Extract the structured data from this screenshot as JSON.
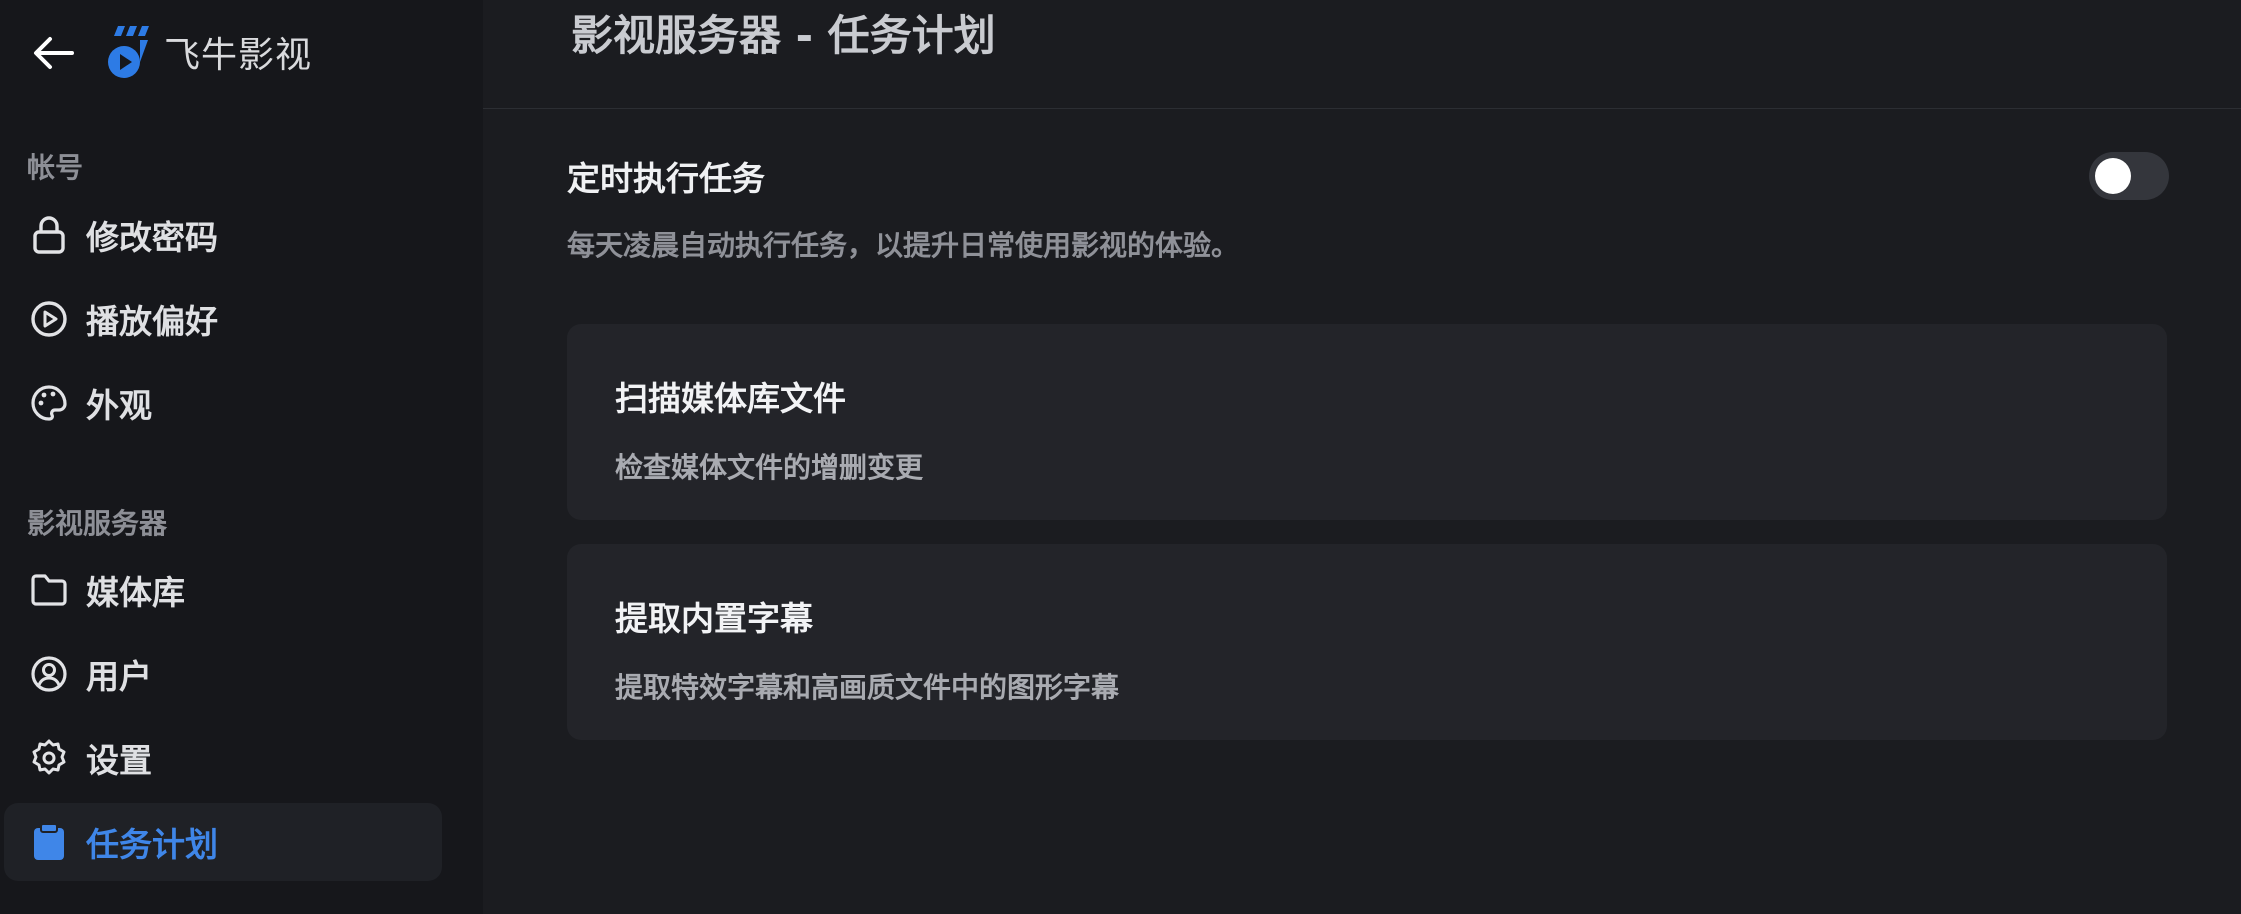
{
  "sidebar": {
    "brand_name": "飞牛影视",
    "sections": [
      {
        "title": "帐号",
        "items": [
          {
            "label": "修改密码",
            "icon": "lock-icon"
          },
          {
            "label": "播放偏好",
            "icon": "play-circle-icon"
          },
          {
            "label": "外观",
            "icon": "palette-icon"
          }
        ]
      },
      {
        "title": "影视服务器",
        "items": [
          {
            "label": "媒体库",
            "icon": "folder-icon"
          },
          {
            "label": "用户",
            "icon": "user-circle-icon"
          },
          {
            "label": "设置",
            "icon": "gear-icon"
          },
          {
            "label": "任务计划",
            "icon": "clipboard-icon",
            "active": true
          }
        ]
      }
    ]
  },
  "main": {
    "title": "影视服务器 - 任务计划",
    "schedule": {
      "title": "定时执行任务",
      "description": "每天凌晨自动执行任务，以提升日常使用影视的体验。",
      "enabled": false
    },
    "tasks": [
      {
        "title": "扫描媒体库文件",
        "description": "检查媒体文件的增删变更"
      },
      {
        "title": "提取内置字幕",
        "description": "提取特效字幕和高画质文件中的图形字幕"
      }
    ]
  },
  "colors": {
    "accent": "#3f86e8",
    "background": "#1b1c20",
    "sidebar": "#16171b",
    "card": "#232429"
  }
}
